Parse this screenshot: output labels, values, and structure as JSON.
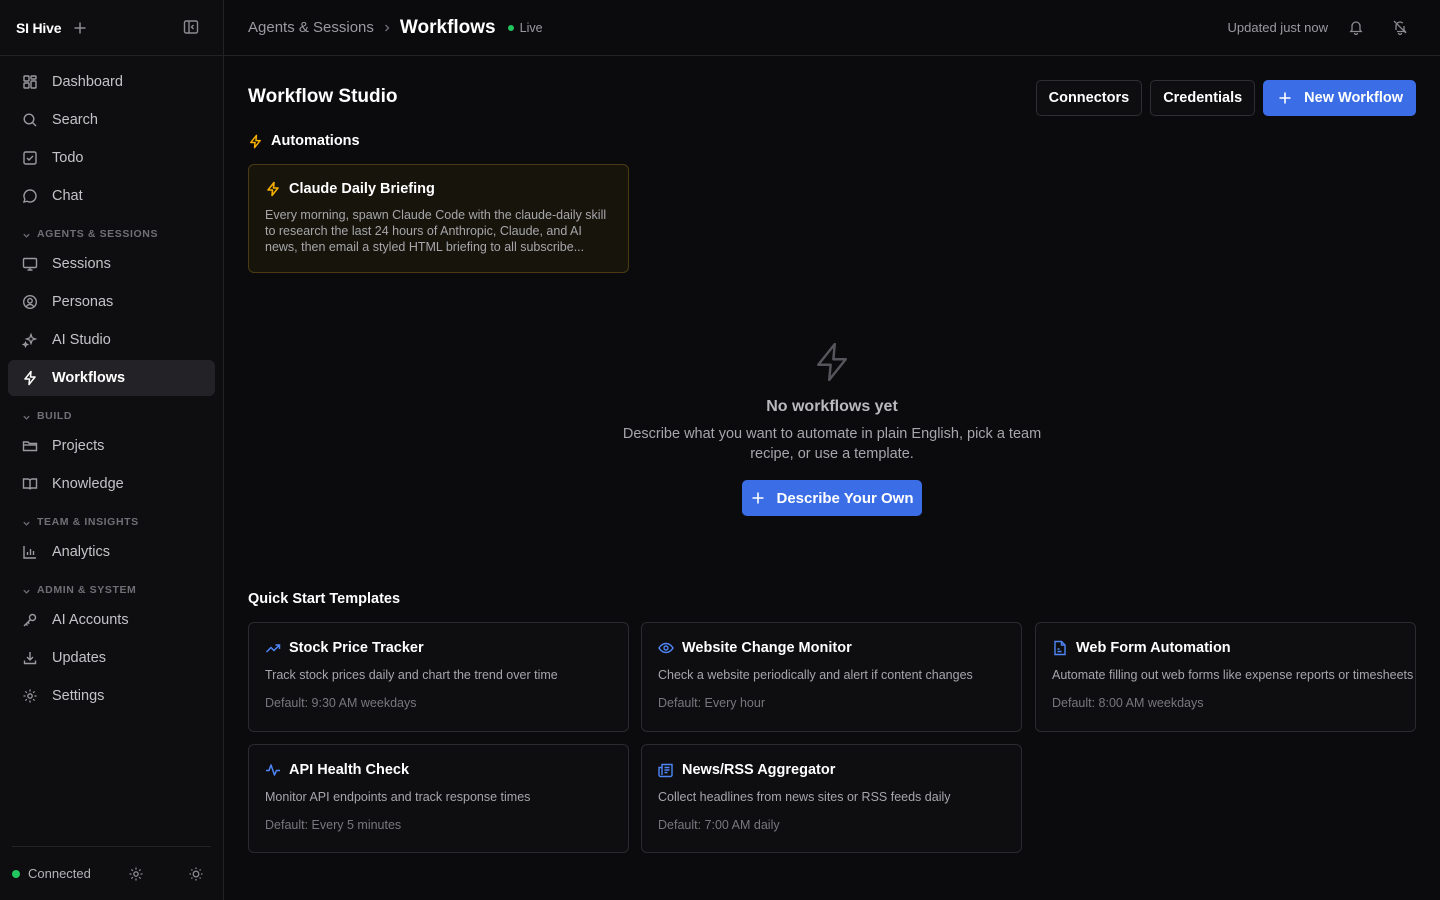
{
  "sidebar": {
    "brand": "SI Hive",
    "primary": [
      {
        "label": "Dashboard",
        "icon": "dashboard-icon"
      },
      {
        "label": "Search",
        "icon": "search-icon"
      },
      {
        "label": "Todo",
        "icon": "todo-icon"
      },
      {
        "label": "Chat",
        "icon": "chat-icon"
      }
    ],
    "groups": [
      {
        "label": "AGENTS & SESSIONS",
        "items": [
          {
            "label": "Sessions",
            "icon": "monitor-icon"
          },
          {
            "label": "Personas",
            "icon": "persona-icon"
          },
          {
            "label": "AI Studio",
            "icon": "sparkles-icon"
          },
          {
            "label": "Workflows",
            "icon": "zap-icon",
            "active": true
          }
        ]
      },
      {
        "label": "BUILD",
        "items": [
          {
            "label": "Projects",
            "icon": "folder-icon"
          },
          {
            "label": "Knowledge",
            "icon": "book-icon"
          }
        ]
      },
      {
        "label": "TEAM & INSIGHTS",
        "items": [
          {
            "label": "Analytics",
            "icon": "bar-chart-icon"
          }
        ]
      },
      {
        "label": "ADMIN & SYSTEM",
        "items": [
          {
            "label": "AI Accounts",
            "icon": "key-icon"
          },
          {
            "label": "Updates",
            "icon": "download-icon"
          },
          {
            "label": "Settings",
            "icon": "gear-icon"
          }
        ]
      }
    ],
    "footer": {
      "status": "Connected",
      "status_color": "#22c55e"
    }
  },
  "topbar": {
    "breadcrumb_parent": "Agents & Sessions",
    "breadcrumb_current": "Workflows",
    "live_label": "Live",
    "updated": "Updated just now"
  },
  "studio": {
    "title": "Workflow Studio",
    "buttons": {
      "connectors": "Connectors",
      "credentials": "Credentials",
      "new_workflow": "New Workflow"
    },
    "accent": "#3b6ee6"
  },
  "automations": {
    "title": "Automations",
    "card": {
      "title": "Claude Daily Briefing",
      "description": "Every morning, spawn Claude Code with the claude-daily skill to research the last 24 hours of Anthropic, Claude, and AI news, then email a styled HTML briefing to all subscribe..."
    }
  },
  "empty_state": {
    "title": "No workflows yet",
    "text": "Describe what you want to automate in plain English, pick a team recipe, or use a template.",
    "button": "Describe Your Own"
  },
  "templates": {
    "title": "Quick Start Templates",
    "items": [
      {
        "title": "Stock Price Tracker",
        "icon": "trending-up-icon",
        "description": "Track stock prices daily and chart the trend over time",
        "default": "Default: 9:30 AM weekdays"
      },
      {
        "title": "Website Change Monitor",
        "icon": "eye-icon",
        "description": "Check a website periodically and alert if content changes",
        "default": "Default: Every hour"
      },
      {
        "title": "Web Form Automation",
        "icon": "file-form-icon",
        "description": "Automate filling out web forms like expense reports or timesheets",
        "default": "Default: 8:00 AM weekdays"
      },
      {
        "title": "API Health Check",
        "icon": "activity-icon",
        "description": "Monitor API endpoints and track response times",
        "default": "Default: Every 5 minutes"
      },
      {
        "title": "News/RSS Aggregator",
        "icon": "newspaper-icon",
        "description": "Collect headlines from news sites or RSS feeds daily",
        "default": "Default: 7:00 AM daily"
      }
    ]
  }
}
